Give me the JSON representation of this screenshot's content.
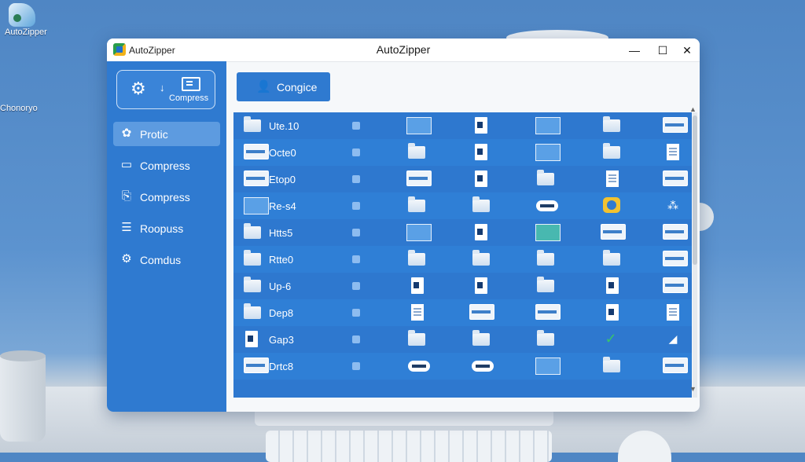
{
  "desktop": {
    "icon_label": "AutoZipper",
    "label2": "Chonoryo"
  },
  "window": {
    "small_title": "AutoZipper",
    "title": "AutoZipper",
    "controls": {
      "minimize": "—",
      "maximize": "☐",
      "close": "✕"
    }
  },
  "sidebar": {
    "tool_card": {
      "label": "Compress"
    },
    "items": [
      {
        "label": "Protic",
        "icon": "star-icon",
        "active": true
      },
      {
        "label": "Compress",
        "icon": "monitor-icon",
        "active": false
      },
      {
        "label": "Compress",
        "icon": "doc-refresh-icon",
        "active": false
      },
      {
        "label": "Roopuss",
        "icon": "list-doc-icon",
        "active": false
      },
      {
        "label": "Comdus",
        "icon": "gear-check-icon",
        "active": false
      }
    ]
  },
  "toolbar": {
    "button_label": "Congice",
    "button_icon": "user-icon"
  },
  "files": {
    "rows": [
      {
        "name": "Ute.10"
      },
      {
        "name": "Octe0"
      },
      {
        "name": "Etop0"
      },
      {
        "name": "Re-s4"
      },
      {
        "name": "Htts5"
      },
      {
        "name": "Rtte0"
      },
      {
        "name": "Up-6"
      },
      {
        "name": "Dep8"
      },
      {
        "name": "Gap3"
      },
      {
        "name": "Drtc8"
      }
    ]
  },
  "colors": {
    "accent": "#2f7ad0",
    "sidebar": "#2f7ad0",
    "active_item": "#5d9be0"
  }
}
